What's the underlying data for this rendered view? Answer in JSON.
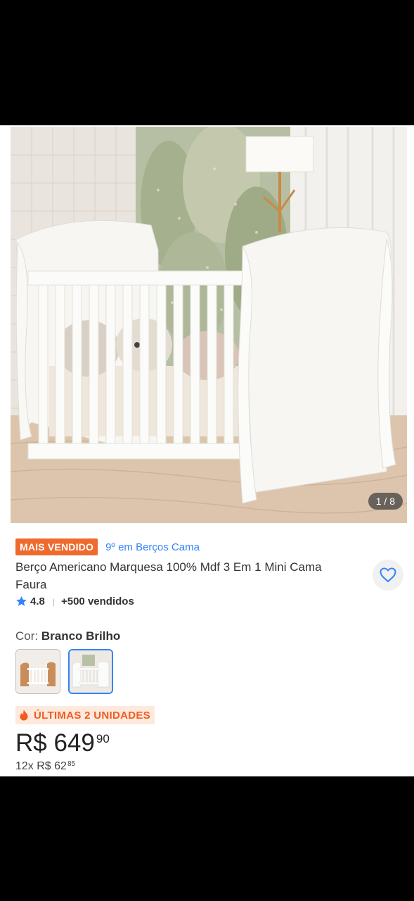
{
  "gallery": {
    "counter": "1 / 8"
  },
  "badges": {
    "best_seller": "MAIS VENDIDO",
    "ranking": "9º em Berços Cama"
  },
  "product": {
    "title": "Berço Americano Marquesa 100% Mdf 3 Em 1 Mini Cama Faura",
    "rating": "4.8",
    "sold": "+500 vendidos"
  },
  "color": {
    "label": "Cor:",
    "selected": "Branco Brilho"
  },
  "stock_warning": "ÚLTIMAS 2 UNIDADES",
  "price": {
    "main": "R$ 649",
    "cents": "90"
  },
  "installments": {
    "main": "12x R$ 62",
    "cents": "85"
  },
  "colors": {
    "accent": "#3483fa",
    "badge": "#ef6a2e",
    "stock_text": "#ef5c1e"
  },
  "icons": {
    "favorite": "heart-outline-icon",
    "rating": "star-icon",
    "stock": "flame-icon"
  }
}
